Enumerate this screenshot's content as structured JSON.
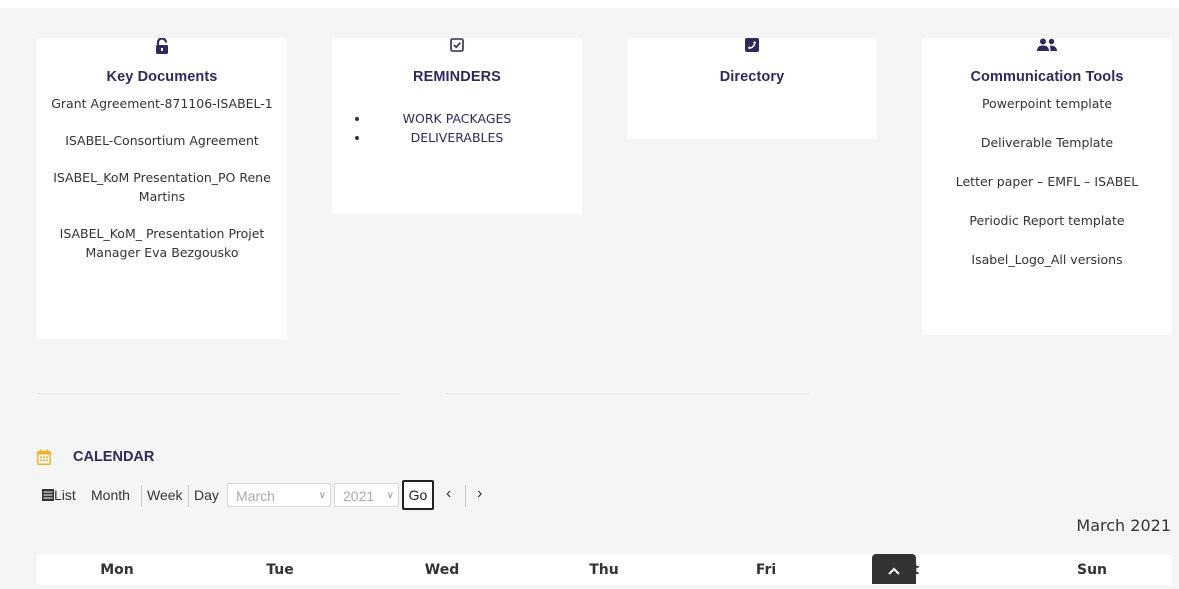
{
  "cards": {
    "key_documents": {
      "title": "Key Documents",
      "icon": "unlock-icon",
      "links": [
        "Grant Agreement-871106-ISABEL-1",
        "ISABEL-Consortium Agreement",
        "ISABEL_KoM Presentation_PO Rene Martins",
        "ISABEL_KoM_ Presentation Projet Manager Eva Bezgousko"
      ]
    },
    "reminders": {
      "title": "REMINDERS",
      "icon": "check-square-icon",
      "items": [
        "WORK PACKAGES",
        "DELIVERABLES"
      ]
    },
    "directory": {
      "title": "Directory",
      "icon": "phone-square-icon"
    },
    "communication_tools": {
      "title": "Communication Tools",
      "icon": "users-icon",
      "links": [
        "Powerpoint template",
        "Deliverable Template",
        "Letter paper – EMFL – ISABEL",
        "Periodic Report template",
        "Isabel_Logo_All versions"
      ]
    }
  },
  "calendar": {
    "title": "CALENDAR",
    "icon": "calendar-icon",
    "views": {
      "list": "List",
      "month": "Month",
      "week": "Week",
      "day": "Day"
    },
    "month_select": "March",
    "year_select": "2021",
    "go_label": "Go",
    "prev": "‹",
    "next": "›",
    "month_title": "March 2021",
    "days": [
      "Mon",
      "Tue",
      "Wed",
      "Thu",
      "Fri",
      "Sat",
      "Sun"
    ]
  },
  "colors": {
    "accent": "#2e2a5c",
    "calendar_icon": "#f0b429"
  }
}
